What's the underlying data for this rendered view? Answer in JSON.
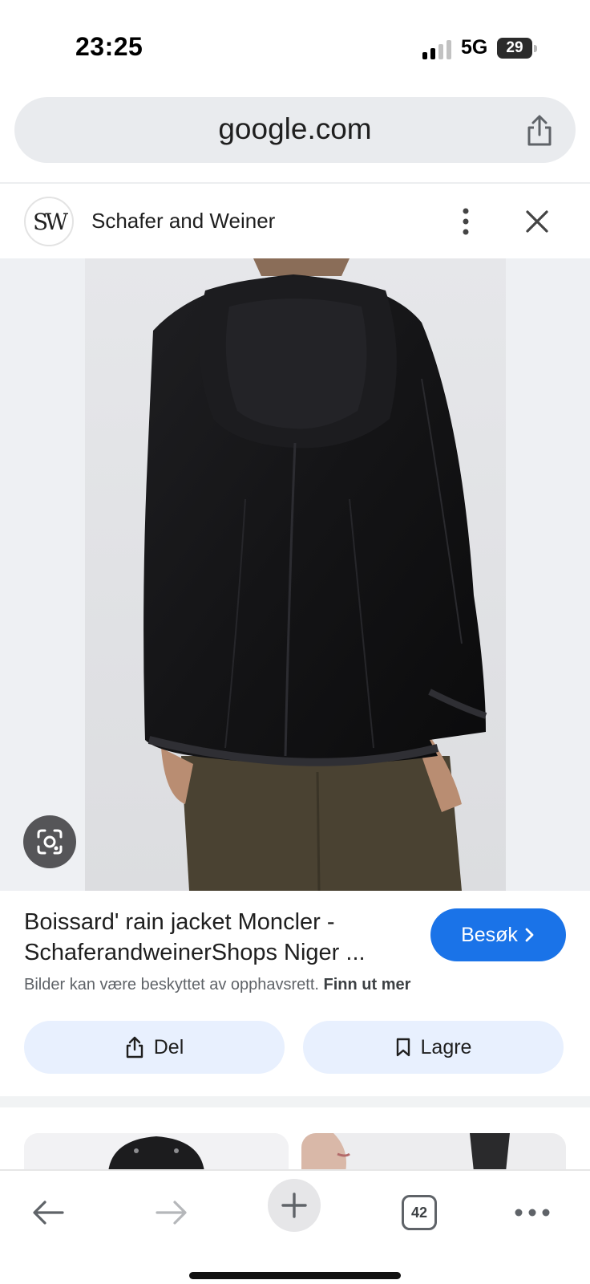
{
  "status": {
    "time": "23:25",
    "network": "5G",
    "battery": "29",
    "signal_bars_active": 2,
    "signal_bars_total": 4
  },
  "url_bar": {
    "domain": "google.com",
    "share_icon": "share-icon"
  },
  "source": {
    "name": "Schafer and Weiner",
    "logo_text": "SW",
    "more_icon": "more-vert-icon",
    "close_icon": "close-icon"
  },
  "image": {
    "lens_icon": "google-lens-icon"
  },
  "result": {
    "title_line1": "Boissard' rain jacket Moncler -",
    "title_line2": "SchaferandweinerShops Niger ...",
    "visit_label": "Besøk",
    "copyright_text": "Bilder kan være beskyttet av opphavsrett.",
    "learn_more": "Finn ut mer"
  },
  "actions": {
    "share_label": "Del",
    "save_label": "Lagre"
  },
  "toolbar": {
    "tab_count": "42",
    "icons": [
      "back-arrow-icon",
      "forward-arrow-icon",
      "plus-icon",
      "tabs-icon",
      "more-horiz-icon"
    ]
  },
  "colors": {
    "accent": "#1a73e8",
    "chip_bg": "#e8f0fe",
    "url_bar_bg": "#e9ebee"
  }
}
